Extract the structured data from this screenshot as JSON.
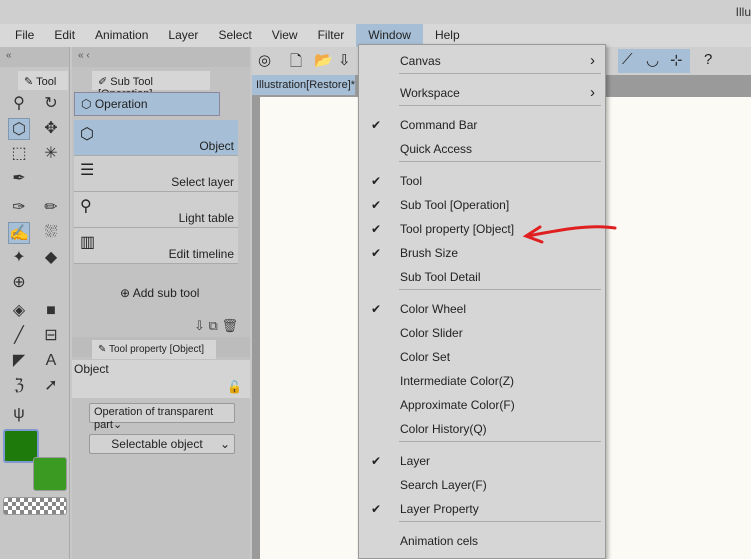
{
  "window": {
    "title": "Illu"
  },
  "menubar": [
    "File",
    "Edit",
    "Animation",
    "Layer",
    "Select",
    "View",
    "Filter",
    "Window",
    "Help"
  ],
  "tool_panel": {
    "tab": "Tool"
  },
  "subtool_panel": {
    "tab": "Sub Tool [Operation]",
    "group": "Operation",
    "items": [
      "Object",
      "Select layer",
      "Light table",
      "Edit timeline"
    ],
    "add_label": "Add sub tool"
  },
  "tool_property": {
    "tab": "Tool property [Object]",
    "name": "Object",
    "dropdown1": "Operation of transparent part",
    "dropdown2": "Selectable object"
  },
  "colors": {
    "main": "#1e7a0a",
    "sub": "#3a9a22"
  },
  "document": {
    "tab": "Illustration[Restore]*"
  },
  "window_menu": {
    "items": [
      {
        "label": "Canvas",
        "checked": false,
        "submenu": true
      },
      {
        "label": "Workspace",
        "checked": false,
        "submenu": true
      },
      {
        "label": "Command Bar",
        "checked": true
      },
      {
        "label": "Quick Access",
        "checked": false
      },
      {
        "label": "Tool",
        "checked": true
      },
      {
        "label": "Sub Tool [Operation]",
        "checked": true
      },
      {
        "label": "Tool property [Object]",
        "checked": true
      },
      {
        "label": "Brush Size",
        "checked": true
      },
      {
        "label": "Sub Tool Detail",
        "checked": false
      },
      {
        "label": "Color Wheel",
        "checked": true
      },
      {
        "label": "Color Slider",
        "checked": false
      },
      {
        "label": "Color Set",
        "checked": false
      },
      {
        "label": "Intermediate Color(Z)",
        "checked": false
      },
      {
        "label": "Approximate Color(F)",
        "checked": false
      },
      {
        "label": "Color History(Q)",
        "checked": false
      },
      {
        "label": "Layer",
        "checked": true
      },
      {
        "label": "Search Layer(F)",
        "checked": false
      },
      {
        "label": "Layer Property",
        "checked": true
      },
      {
        "label": "Animation cels",
        "checked": false
      }
    ]
  },
  "annotation": {
    "color": "#e02020"
  }
}
